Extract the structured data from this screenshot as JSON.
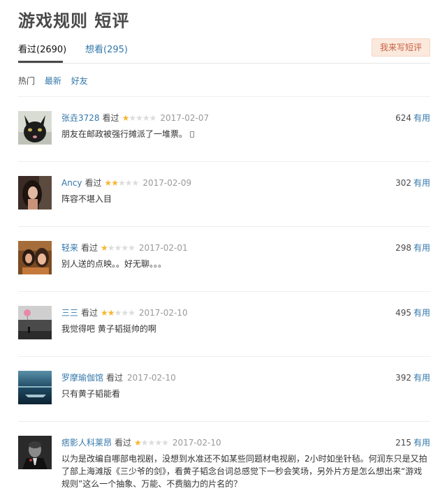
{
  "page": {
    "title": "游戏规则 短评"
  },
  "tabs": {
    "watched": "看过(2690)",
    "want": "想看(295)",
    "write_button": "我来写短评"
  },
  "filters": {
    "hot": "热门",
    "latest": "最新",
    "friends": "好友"
  },
  "comments": [
    {
      "user": "张垚3728",
      "status": "看过",
      "rating": 1,
      "max_rating": 5,
      "date": "2017-02-07",
      "votes": "624",
      "vote_label": "有用",
      "text": "朋友在邮政被强行摊派了一堆票。",
      "text_icon": "phone-icon",
      "avatar": "black-cat-avatar"
    },
    {
      "user": "Ancy",
      "status": "看过",
      "rating": 2,
      "max_rating": 5,
      "date": "2017-02-09",
      "votes": "302",
      "vote_label": "有用",
      "text": "阵容不堪入目",
      "avatar": "woman-portrait-avatar"
    },
    {
      "user": "轻来",
      "status": "看过",
      "rating": 1,
      "max_rating": 5,
      "date": "2017-02-01",
      "votes": "298",
      "vote_label": "有用",
      "text": "别人送的点映。。好无聊。。。",
      "avatar": "two-girls-avatar"
    },
    {
      "user": "三三",
      "status": "看过",
      "rating": 2,
      "max_rating": 5,
      "date": "2017-02-10",
      "votes": "495",
      "vote_label": "有用",
      "text": "我觉得吧 黄子韬挺帅的啊",
      "avatar": "balloon-street-avatar"
    },
    {
      "user": "罗摩瑜伽馆",
      "status": "看过",
      "rating": 0,
      "max_rating": 5,
      "date": "2017-02-10",
      "votes": "392",
      "vote_label": "有用",
      "text": "只有黄子韬能看",
      "avatar": "ocean-dusk-avatar"
    },
    {
      "user": "痞影人科莱昂",
      "status": "看过",
      "rating": 1,
      "max_rating": 5,
      "date": "2017-02-10",
      "votes": "215",
      "vote_label": "有用",
      "text": "以为是改编自哪部电视剧，没想到水准还不如某些同题材电视剧，2小时如坐针毡。何润东只是又拍了部上海滩版《三少爷的剑》，看黄子韬念台词总感觉下一秒会笑场，另外片方是怎么想出来“游戏规则”这么一个抽象、万能、不费脑力的片名的？",
      "avatar": "godfather-avatar"
    }
  ]
}
